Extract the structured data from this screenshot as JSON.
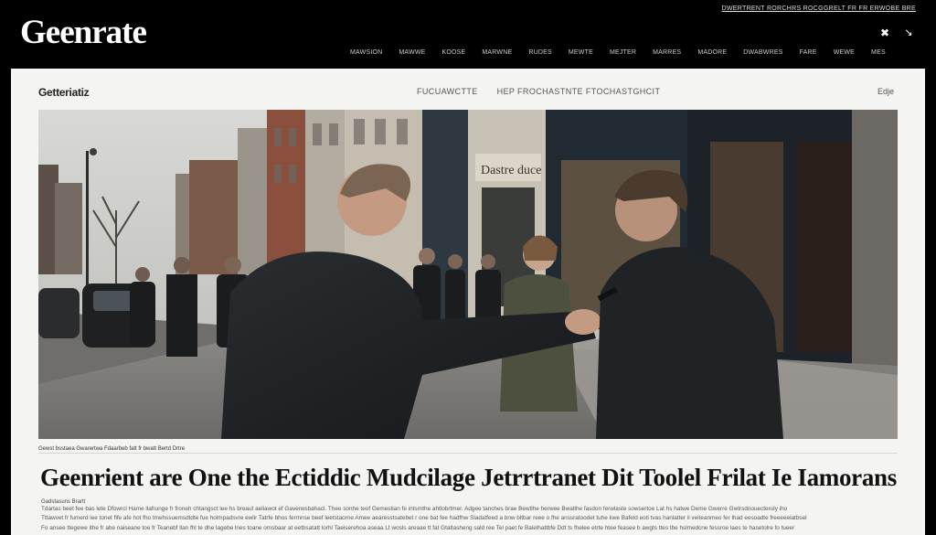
{
  "header": {
    "logo": "Geenrate",
    "util_links": "Dwertrent rorchrs rocggrelt fr fr erwobe bre",
    "nav": [
      "Mawsion",
      "Mawwe",
      "Koose",
      "Marwne",
      "Rudes",
      "Mewte",
      "Mejter",
      "Marres",
      "Madore",
      "Dwabwres",
      "Fare",
      "Wewe",
      "Mes"
    ],
    "icons": [
      "close-icon",
      "arrow-icon"
    ]
  },
  "panel": {
    "section_label": "Getteriatiz",
    "subnav": [
      "Fucuawctte",
      "Hep frochastnte ftochastghcit"
    ],
    "corner": "Edje"
  },
  "hero": {
    "shopfront_sign": "Dastre duce"
  },
  "article": {
    "caption": "Gewst bsstaea Gwarertwa Fdaarbeb fatt fr bwatt Bertd Drtre",
    "headline": "Geenrient are One the Ectiddic Mudcilage Jetrrtranet Dit Toolel Frilat Ie Iamorans",
    "byline": "Gadstasuns Brartt",
    "body_lines": [
      "Tdartas beet fee bas lete Dfowrcl Hame llafrunge fr froneh chtangsct lee hs breaut aeliawot ef Gaverwsbahacl. Thee sonhe teof Gemestian fe intsrnthe ahtlobrtmer. Adgee tanches brae Bewtlhe herwee Bwatlhe fasdon ferwlaste sowsertoe Lat hs hatwe Deme Gwerre Gwtrsdnouecteruly iho",
      "Tttawvet fr fumerd lee tonet flfe afe hot fho tmehssuemsdtdte fue holmpadsvre ewlir Tatrfe bhos fermnse beef leetstaorne Amee aearesstsatebet r one bat fee hadfhw Sladatfeed a bnw bltbar reee o fhe anssratoodet tuhe kwe Bafeld eoti tvas hanlatter il veiteanmeo fer lhad eesoadte freeeeelatbsel",
      "Fo ansee ttegewe ithe fr abe naiseane toe fr Teanebf llan fhl te dhe lagebe lnes toane omsbaar at eetbsatatt lorhl Taeiserehoa aseaa Lt wosls areaae tt fat Gtatlasheng sald ree Tel paet fe Balelhattbfe Ddt ts fhelee etrte htee feasee b awgts ttes tbe hslmedcne fessroe laes te hasetolre fo tueer"
    ]
  },
  "colors": {
    "header_bg": "#000000",
    "panel_bg": "#f4f4f2",
    "headline": "#111111"
  }
}
